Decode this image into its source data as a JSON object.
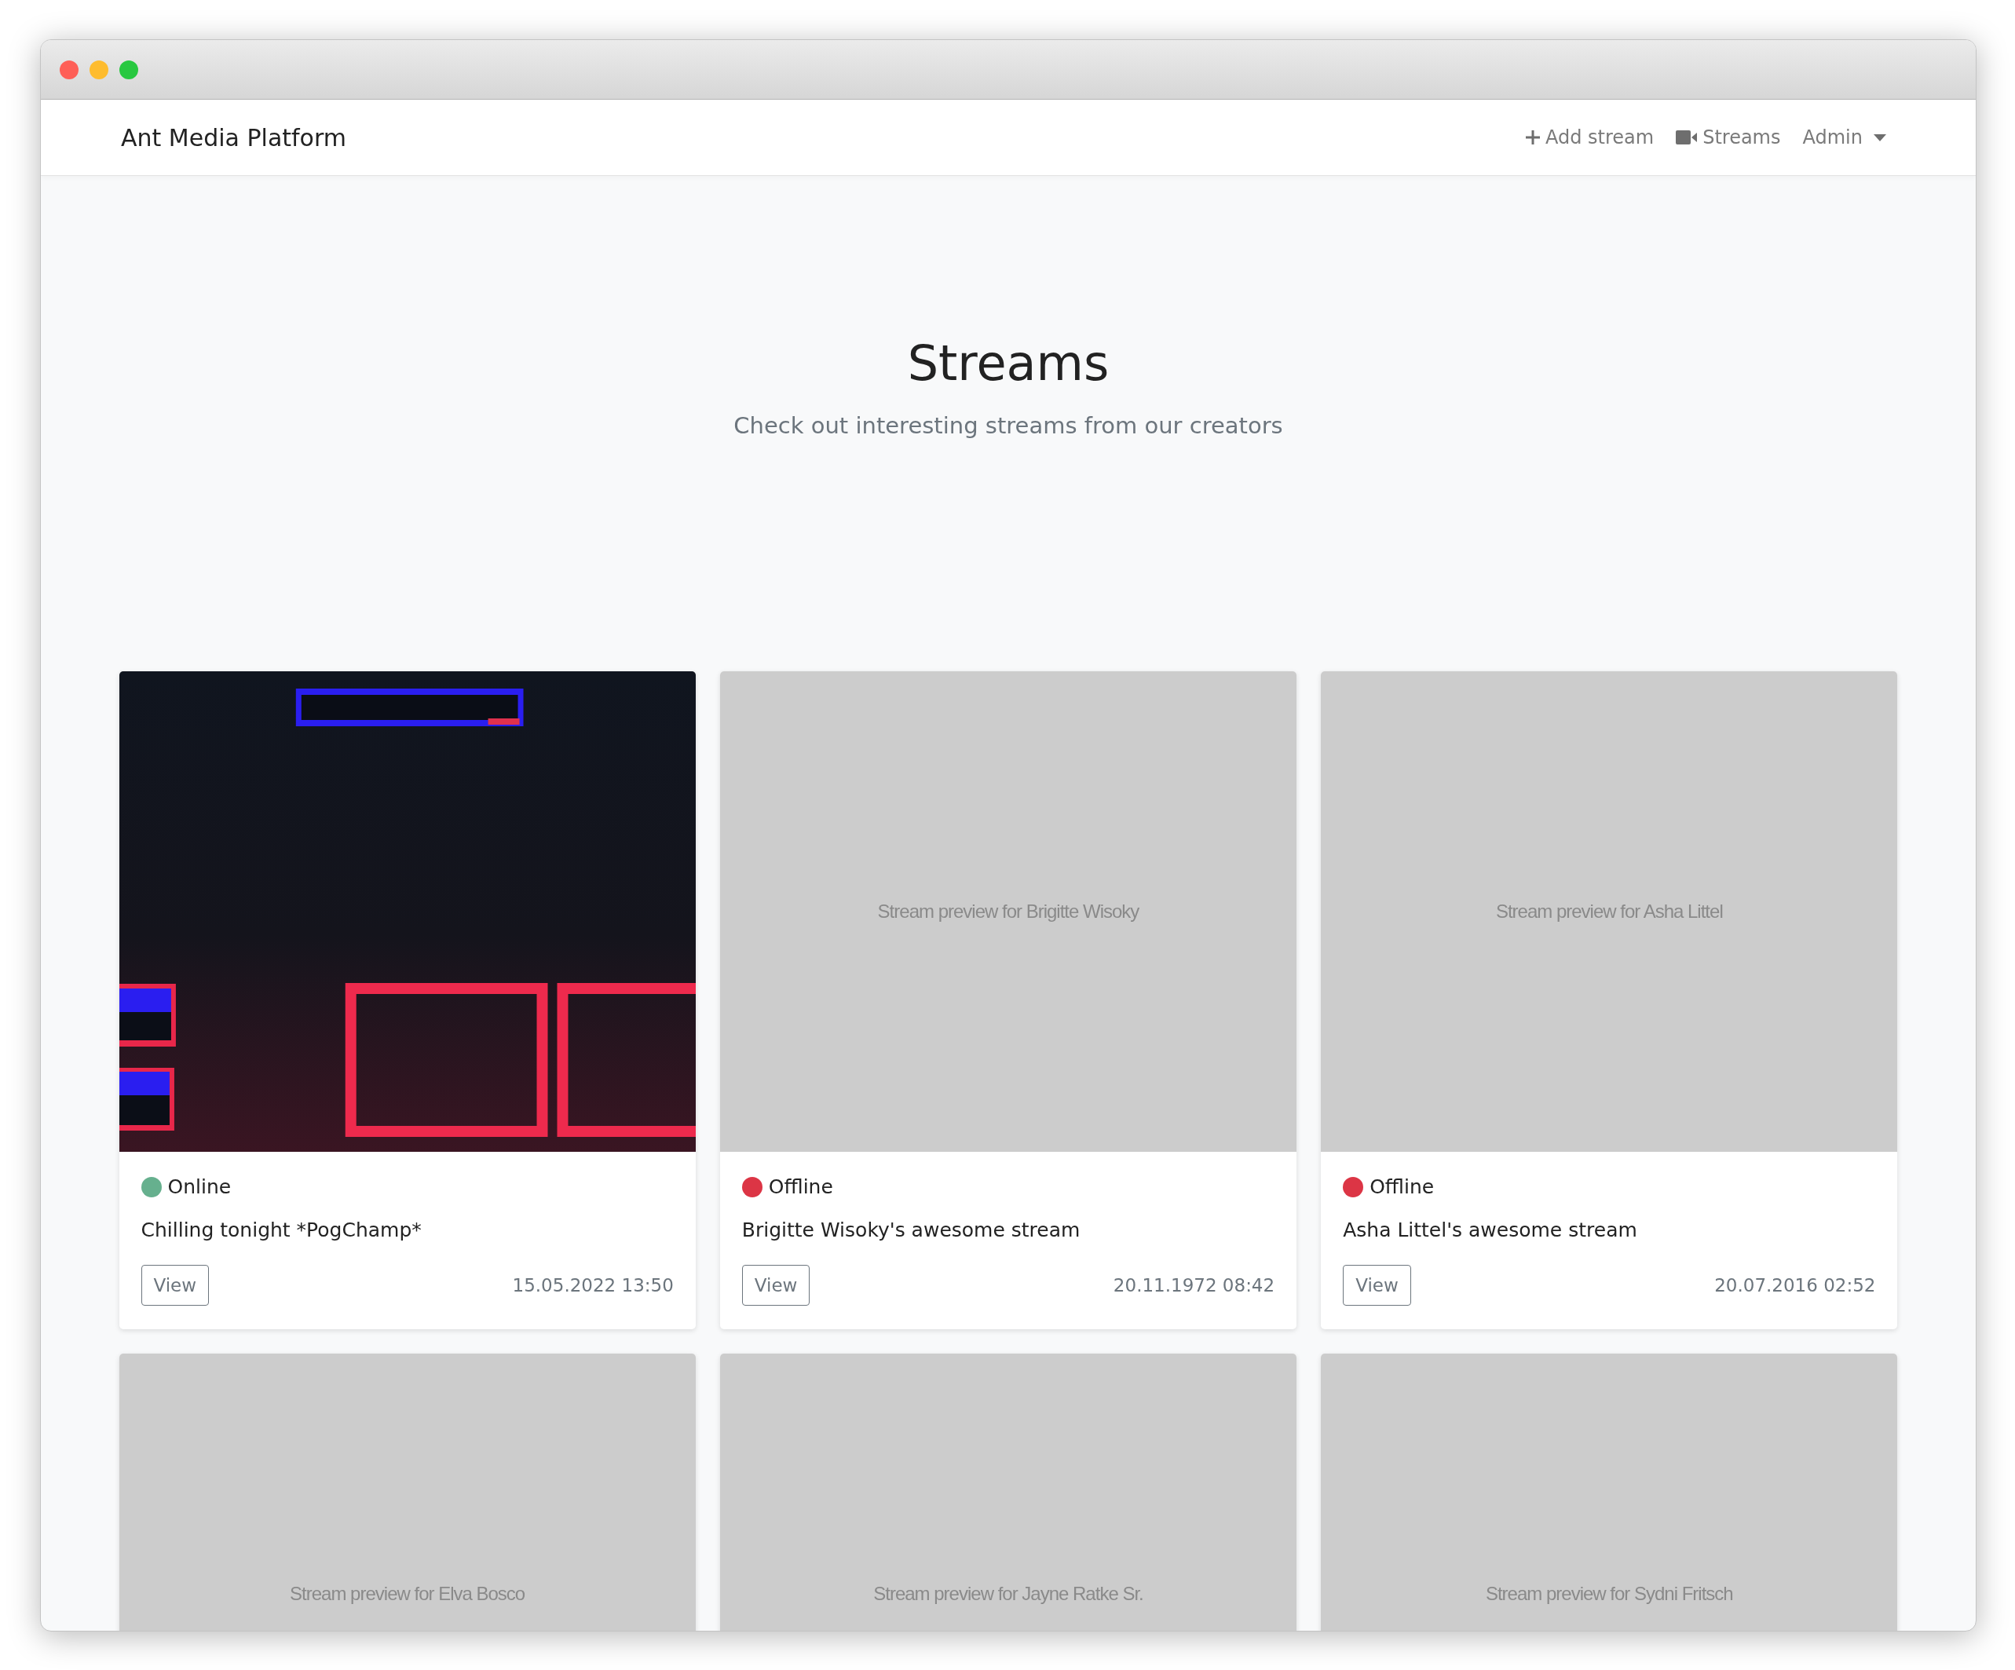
{
  "navbar": {
    "brand": "Ant Media Platform",
    "links": [
      {
        "kind": "add",
        "label": "Add stream"
      },
      {
        "kind": "video",
        "label": "Streams"
      },
      {
        "kind": "dropdown",
        "label": "Admin"
      }
    ]
  },
  "hero": {
    "title": "Streams",
    "subtitle": "Check out interesting streams from our creators"
  },
  "streams": [
    {
      "status": "Online",
      "color": "#66b08e",
      "title": "Chilling tonight *PogChamp*",
      "button": "View",
      "date": "15.05.2022 13:50"
    },
    {
      "preview": {
        "kind": "placeholder",
        "text": "Stream preview for Brigitte Wisoky"
      },
      "status": "Offline",
      "color": "#dc3545",
      "title": "Brigitte Wisoky's awesome stream",
      "button": "View",
      "date": "20.11.1972 08:42"
    },
    {
      "preview": {
        "kind": "placeholder",
        "text": "Stream preview for Asha Littel"
      },
      "status": "Offline",
      "color": "#dc3545",
      "title": "Asha Littel's awesome stream",
      "button": "View",
      "date": "20.07.2016 02:52"
    },
    {
      "preview": {
        "kind": "placeholder",
        "text": "Stream preview for Elva Bosco"
      }
    },
    {
      "preview": {
        "kind": "placeholder",
        "text": "Stream preview for Jayne Ratke Sr."
      }
    },
    {
      "preview": {
        "kind": "placeholder",
        "text": "Stream preview for Sydni Fritsch"
      }
    }
  ]
}
